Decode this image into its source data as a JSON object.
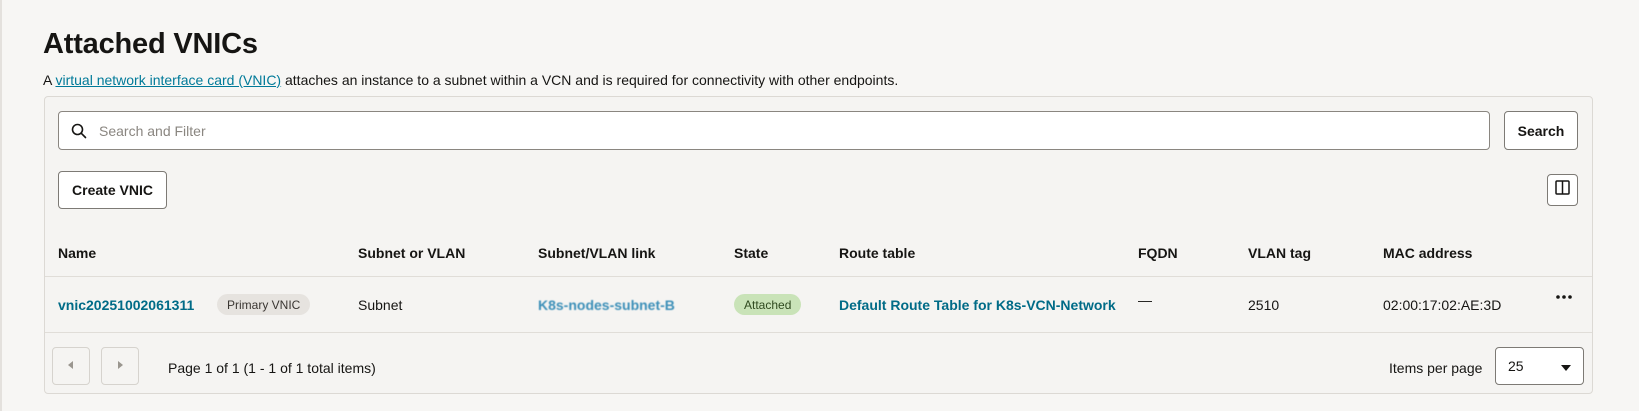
{
  "page": {
    "title": "Attached VNICs",
    "description_prefix": "A ",
    "description_link": "virtual network interface card (VNIC)",
    "description_suffix": " attaches an instance to a subnet within a VCN and is required for connectivity with other endpoints."
  },
  "toolbar": {
    "search_placeholder": "Search and Filter",
    "search_value": "",
    "search_button": "Search",
    "create_button": "Create VNIC",
    "columns_icon": "columns-icon"
  },
  "table": {
    "columns": [
      "Name",
      "Subnet or VLAN",
      "Subnet/VLAN link",
      "State",
      "Route table",
      "FQDN",
      "VLAN tag",
      "MAC address"
    ],
    "rows": [
      {
        "name": "vnic20251002061311",
        "badge": "Primary VNIC",
        "subnet_or_vlan": "Subnet",
        "subnet_link": "K8s-nodes-subnet-B",
        "state": "Attached",
        "route_table": "Default Route Table for K8s-VCN-Network",
        "fqdn": "—",
        "vlan_tag": "2510",
        "mac_address": "02:00:17:02:AE:3D",
        "actions_icon": "more-actions-icon"
      }
    ]
  },
  "pagination": {
    "info": "Page 1 of 1 (1 - 1 of 1 total items)",
    "items_per_page_label": "Items per page",
    "items_per_page_value": "25"
  },
  "colors": {
    "link": "#006b87",
    "attached_badge_bg": "#c9e3b8",
    "primary_badge_bg": "#e6e3df",
    "page_bg": "#f7f6f4"
  }
}
